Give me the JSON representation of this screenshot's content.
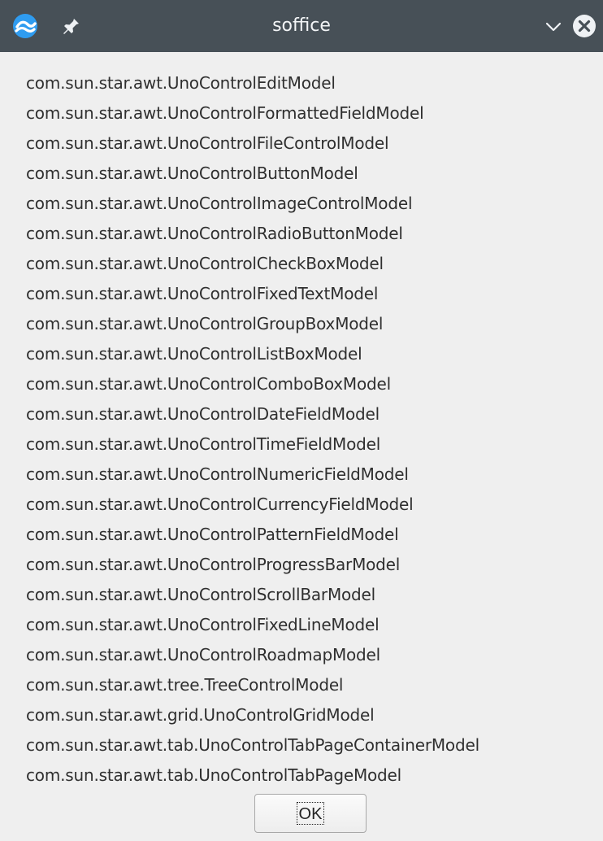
{
  "window": {
    "title": "soffice"
  },
  "icons": {
    "app": "libreoffice-icon",
    "pin": "pin-icon",
    "minimize": "chevron-down-icon",
    "close": "close-icon"
  },
  "colors": {
    "titlebar": "#475057",
    "close_bg": "#eef1f4",
    "app_icon_blue": "#2f9cf0",
    "content_bg": "#efefef"
  },
  "items": [
    "com.sun.star.awt.UnoControlEditModel",
    "com.sun.star.awt.UnoControlFormattedFieldModel",
    "com.sun.star.awt.UnoControlFileControlModel",
    "com.sun.star.awt.UnoControlButtonModel",
    "com.sun.star.awt.UnoControlImageControlModel",
    "com.sun.star.awt.UnoControlRadioButtonModel",
    "com.sun.star.awt.UnoControlCheckBoxModel",
    "com.sun.star.awt.UnoControlFixedTextModel",
    "com.sun.star.awt.UnoControlGroupBoxModel",
    "com.sun.star.awt.UnoControlListBoxModel",
    "com.sun.star.awt.UnoControlComboBoxModel",
    "com.sun.star.awt.UnoControlDateFieldModel",
    "com.sun.star.awt.UnoControlTimeFieldModel",
    "com.sun.star.awt.UnoControlNumericFieldModel",
    "com.sun.star.awt.UnoControlCurrencyFieldModel",
    "com.sun.star.awt.UnoControlPatternFieldModel",
    "com.sun.star.awt.UnoControlProgressBarModel",
    "com.sun.star.awt.UnoControlScrollBarModel",
    "com.sun.star.awt.UnoControlFixedLineModel",
    "com.sun.star.awt.UnoControlRoadmapModel",
    "com.sun.star.awt.tree.TreeControlModel",
    "com.sun.star.awt.grid.UnoControlGridModel",
    "com.sun.star.awt.tab.UnoControlTabPageContainerModel",
    "com.sun.star.awt.tab.UnoControlTabPageModel"
  ],
  "buttons": {
    "ok": "OK"
  }
}
